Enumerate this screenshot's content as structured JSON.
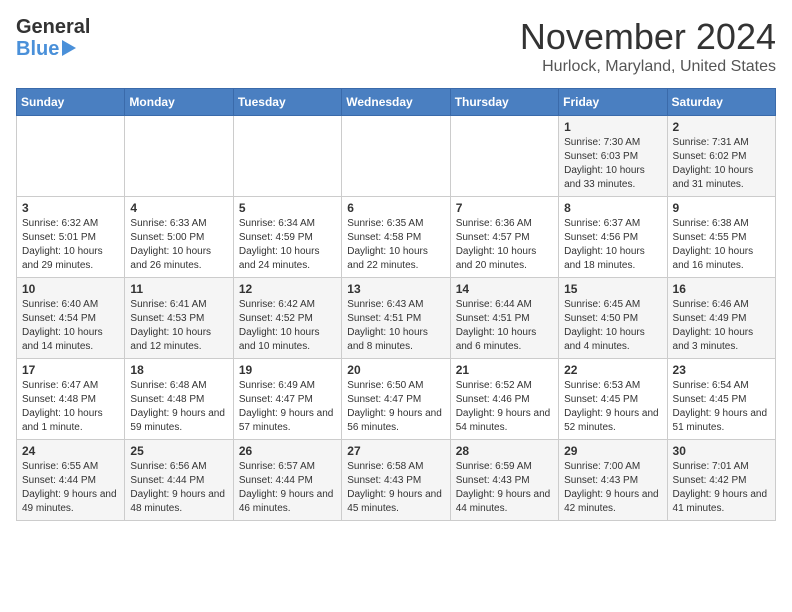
{
  "header": {
    "logo_general": "General",
    "logo_blue": "Blue",
    "title": "November 2024",
    "subtitle": "Hurlock, Maryland, United States"
  },
  "weekdays": [
    "Sunday",
    "Monday",
    "Tuesday",
    "Wednesday",
    "Thursday",
    "Friday",
    "Saturday"
  ],
  "weeks": [
    [
      {
        "day": "",
        "info": ""
      },
      {
        "day": "",
        "info": ""
      },
      {
        "day": "",
        "info": ""
      },
      {
        "day": "",
        "info": ""
      },
      {
        "day": "",
        "info": ""
      },
      {
        "day": "1",
        "info": "Sunrise: 7:30 AM\nSunset: 6:03 PM\nDaylight: 10 hours and 33 minutes."
      },
      {
        "day": "2",
        "info": "Sunrise: 7:31 AM\nSunset: 6:02 PM\nDaylight: 10 hours and 31 minutes."
      }
    ],
    [
      {
        "day": "3",
        "info": "Sunrise: 6:32 AM\nSunset: 5:01 PM\nDaylight: 10 hours and 29 minutes."
      },
      {
        "day": "4",
        "info": "Sunrise: 6:33 AM\nSunset: 5:00 PM\nDaylight: 10 hours and 26 minutes."
      },
      {
        "day": "5",
        "info": "Sunrise: 6:34 AM\nSunset: 4:59 PM\nDaylight: 10 hours and 24 minutes."
      },
      {
        "day": "6",
        "info": "Sunrise: 6:35 AM\nSunset: 4:58 PM\nDaylight: 10 hours and 22 minutes."
      },
      {
        "day": "7",
        "info": "Sunrise: 6:36 AM\nSunset: 4:57 PM\nDaylight: 10 hours and 20 minutes."
      },
      {
        "day": "8",
        "info": "Sunrise: 6:37 AM\nSunset: 4:56 PM\nDaylight: 10 hours and 18 minutes."
      },
      {
        "day": "9",
        "info": "Sunrise: 6:38 AM\nSunset: 4:55 PM\nDaylight: 10 hours and 16 minutes."
      }
    ],
    [
      {
        "day": "10",
        "info": "Sunrise: 6:40 AM\nSunset: 4:54 PM\nDaylight: 10 hours and 14 minutes."
      },
      {
        "day": "11",
        "info": "Sunrise: 6:41 AM\nSunset: 4:53 PM\nDaylight: 10 hours and 12 minutes."
      },
      {
        "day": "12",
        "info": "Sunrise: 6:42 AM\nSunset: 4:52 PM\nDaylight: 10 hours and 10 minutes."
      },
      {
        "day": "13",
        "info": "Sunrise: 6:43 AM\nSunset: 4:51 PM\nDaylight: 10 hours and 8 minutes."
      },
      {
        "day": "14",
        "info": "Sunrise: 6:44 AM\nSunset: 4:51 PM\nDaylight: 10 hours and 6 minutes."
      },
      {
        "day": "15",
        "info": "Sunrise: 6:45 AM\nSunset: 4:50 PM\nDaylight: 10 hours and 4 minutes."
      },
      {
        "day": "16",
        "info": "Sunrise: 6:46 AM\nSunset: 4:49 PM\nDaylight: 10 hours and 3 minutes."
      }
    ],
    [
      {
        "day": "17",
        "info": "Sunrise: 6:47 AM\nSunset: 4:48 PM\nDaylight: 10 hours and 1 minute."
      },
      {
        "day": "18",
        "info": "Sunrise: 6:48 AM\nSunset: 4:48 PM\nDaylight: 9 hours and 59 minutes."
      },
      {
        "day": "19",
        "info": "Sunrise: 6:49 AM\nSunset: 4:47 PM\nDaylight: 9 hours and 57 minutes."
      },
      {
        "day": "20",
        "info": "Sunrise: 6:50 AM\nSunset: 4:47 PM\nDaylight: 9 hours and 56 minutes."
      },
      {
        "day": "21",
        "info": "Sunrise: 6:52 AM\nSunset: 4:46 PM\nDaylight: 9 hours and 54 minutes."
      },
      {
        "day": "22",
        "info": "Sunrise: 6:53 AM\nSunset: 4:45 PM\nDaylight: 9 hours and 52 minutes."
      },
      {
        "day": "23",
        "info": "Sunrise: 6:54 AM\nSunset: 4:45 PM\nDaylight: 9 hours and 51 minutes."
      }
    ],
    [
      {
        "day": "24",
        "info": "Sunrise: 6:55 AM\nSunset: 4:44 PM\nDaylight: 9 hours and 49 minutes."
      },
      {
        "day": "25",
        "info": "Sunrise: 6:56 AM\nSunset: 4:44 PM\nDaylight: 9 hours and 48 minutes."
      },
      {
        "day": "26",
        "info": "Sunrise: 6:57 AM\nSunset: 4:44 PM\nDaylight: 9 hours and 46 minutes."
      },
      {
        "day": "27",
        "info": "Sunrise: 6:58 AM\nSunset: 4:43 PM\nDaylight: 9 hours and 45 minutes."
      },
      {
        "day": "28",
        "info": "Sunrise: 6:59 AM\nSunset: 4:43 PM\nDaylight: 9 hours and 44 minutes."
      },
      {
        "day": "29",
        "info": "Sunrise: 7:00 AM\nSunset: 4:43 PM\nDaylight: 9 hours and 42 minutes."
      },
      {
        "day": "30",
        "info": "Sunrise: 7:01 AM\nSunset: 4:42 PM\nDaylight: 9 hours and 41 minutes."
      }
    ]
  ]
}
